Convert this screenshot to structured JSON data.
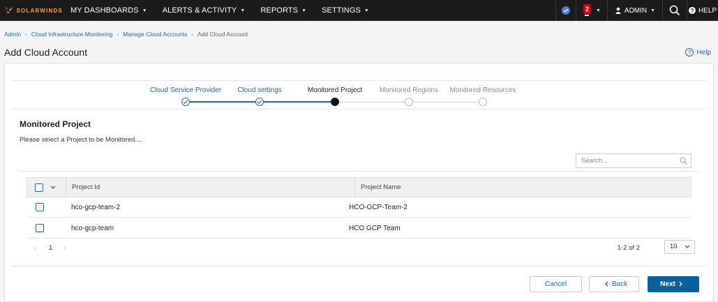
{
  "nav": {
    "brand": "SOLARWINDS",
    "items": [
      {
        "label": "MY DASHBOARDS"
      },
      {
        "label": "ALERTS & ACTIVITY"
      },
      {
        "label": "REPORTS"
      },
      {
        "label": "SETTINGS"
      }
    ],
    "notification_count": "2",
    "user": "ADMIN",
    "help": "HELP"
  },
  "breadcrumb": [
    "Admin",
    "Cloud Infrastructure Monitoring",
    "Manage Cloud Accounts",
    "Add Cloud Account"
  ],
  "page": {
    "title": "Add Cloud Account",
    "help": "Help"
  },
  "wizard": {
    "steps": [
      {
        "label": "Cloud Service Provider",
        "state": "done"
      },
      {
        "label": "Cloud settings",
        "state": "done"
      },
      {
        "label": "Monitored Project",
        "state": "active"
      },
      {
        "label": "Monitored Regions",
        "state": "pending"
      },
      {
        "label": "Monitored Resources",
        "state": "pending"
      }
    ]
  },
  "section": {
    "title": "Monitored Project",
    "description": "Please select a Project to be Monitored...."
  },
  "search": {
    "placeholder": "Search...",
    "value": ""
  },
  "table": {
    "columns": [
      "Project Id",
      "Project Name"
    ],
    "rows": [
      {
        "id": "hco-gcp-team-2",
        "name": "HCO-GCP-Team-2"
      },
      {
        "id": "hco-gcp-team",
        "name": "HCO GCP Team"
      }
    ]
  },
  "pager": {
    "current_page": "1",
    "range": "1-2 of 2",
    "page_size": "10"
  },
  "footer": {
    "cancel": "Cancel",
    "back": "Back",
    "next": "Next"
  },
  "colors": {
    "accent": "#1a6aa8",
    "primary_button": "#0d5f9a",
    "brand": "#f5a623",
    "badge": "#d0021b"
  }
}
